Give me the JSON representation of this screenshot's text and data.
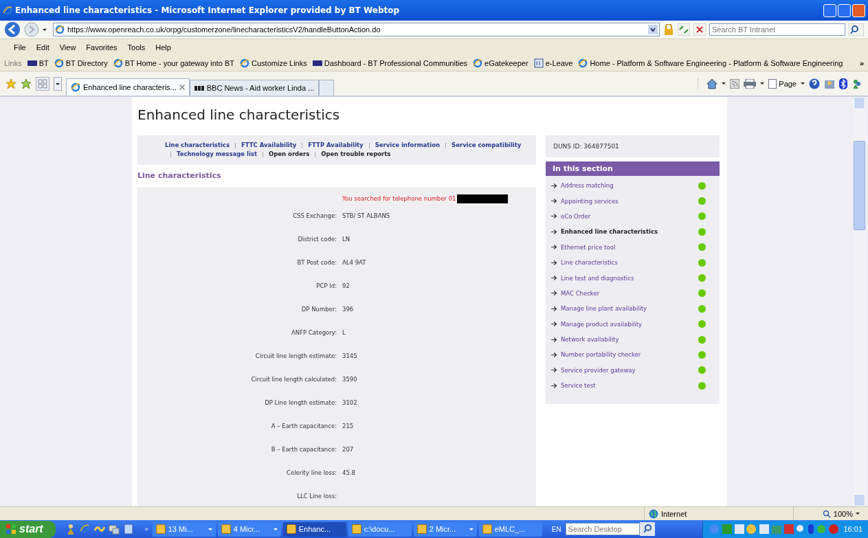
{
  "window": {
    "title": "Enhanced line characteristics - Microsoft Internet Explorer provided by BT Webtop"
  },
  "address_bar": {
    "url": "https://www.openreach.co.uk/orpg/customerzone/linecharacteristicsV2/handleButtonAction.do",
    "search_placeholder": "Search BT Intranet"
  },
  "menu": [
    "File",
    "Edit",
    "View",
    "Favorites",
    "Tools",
    "Help"
  ],
  "links_bar": {
    "label": "Links",
    "more": "»",
    "items": [
      {
        "label": "BT",
        "kind": "bt"
      },
      {
        "label": "BT Directory",
        "kind": "ie"
      },
      {
        "label": "BT Home - your gateway into BT",
        "kind": "ie"
      },
      {
        "label": "Customize Links",
        "kind": "ie"
      },
      {
        "label": "Dashboard - BT Professional Communities",
        "kind": "bt"
      },
      {
        "label": "eGatekeeper",
        "kind": "ie"
      },
      {
        "label": "e-Leave",
        "kind": "doc"
      },
      {
        "label": "Home - Platform & Software Engineering - Platform & Software Engineering",
        "kind": "ie"
      }
    ]
  },
  "tabs": [
    {
      "label": "Enhanced line characteris...",
      "selected": true,
      "kind": "ie"
    },
    {
      "label": "BBC News - Aid worker Linda ...",
      "selected": false,
      "kind": "bbc"
    }
  ],
  "command_bar": {
    "page": "Page"
  },
  "page": {
    "title": "Enhanced line characteristics",
    "nav": [
      {
        "label": "Line characteristics",
        "kind": "link"
      },
      {
        "label": "FTTC Availability",
        "kind": "link"
      },
      {
        "label": "FTTP Availability",
        "kind": "link"
      },
      {
        "label": "Service information",
        "kind": "link"
      },
      {
        "label": "Service compatibility",
        "kind": "link"
      },
      {
        "label": "Technology message list",
        "kind": "link"
      },
      {
        "label": "Open orders",
        "kind": "text"
      },
      {
        "label": "Open trouble reports",
        "kind": "text"
      }
    ],
    "section_heading": "Line characteristics",
    "search_notice": "You searched for telephone number 01",
    "fields": [
      {
        "label": "CSS Exchange:",
        "value": "STB/ ST ALBANS"
      },
      {
        "label": "District code:",
        "value": "LN"
      },
      {
        "label": "BT Post code:",
        "value": "AL4 9AT"
      },
      {
        "label": "PCP Id:",
        "value": "92"
      },
      {
        "label": "DP Number:",
        "value": "396"
      },
      {
        "label": "ANFP Category:",
        "value": "L"
      },
      {
        "label": "Circuit line length estimate:",
        "value": "3145"
      },
      {
        "label": "Circuit line length calculated:",
        "value": "3590"
      },
      {
        "label": "DP Line length estimate:",
        "value": "3102"
      },
      {
        "label": "A – Earth capacitance:",
        "value": "215"
      },
      {
        "label": "B – Earth capacitance:",
        "value": "207"
      },
      {
        "label": "Celerity line loss:",
        "value": "45.8"
      },
      {
        "label": "LLC Line loss:"
      }
    ],
    "sidebar": {
      "duns": "DUNS ID: 364877501",
      "heading": "In this section",
      "items": [
        {
          "label": "Address matching",
          "selected": false,
          "color": "#66cc00"
        },
        {
          "label": "Appointing services",
          "selected": false,
          "color": "#66cc00"
        },
        {
          "label": "eCo Order",
          "selected": false,
          "color": "#66cc00"
        },
        {
          "label": "Enhanced line characteristics",
          "selected": true,
          "color": "#66cc00"
        },
        {
          "label": "Ethernet price tool",
          "selected": false,
          "color": "#66cc00"
        },
        {
          "label": "Line characteristics",
          "selected": false,
          "color": "#66cc00"
        },
        {
          "label": "Line test and diagnostics",
          "selected": false,
          "color": "#66cc00"
        },
        {
          "label": "MAC Checker",
          "selected": false,
          "color": "#66cc00"
        },
        {
          "label": "Manage line plant availability",
          "selected": false,
          "color": "#66cc00"
        },
        {
          "label": "Manage product availability",
          "selected": false,
          "color": "#66cc00"
        },
        {
          "label": "Network availability",
          "selected": false,
          "color": "#66cc00"
        },
        {
          "label": "Number portability checker",
          "selected": false,
          "color": "#66cc00"
        },
        {
          "label": "Service provider gateway",
          "selected": false,
          "color": "#66cc00"
        },
        {
          "label": "Service test",
          "selected": false,
          "color": "#66cc00"
        }
      ]
    }
  },
  "status_bar": {
    "zone": "Internet",
    "zoom": "100%"
  },
  "taskbar": {
    "start": "start",
    "more": "»",
    "tasks": [
      {
        "label": "13 Mi...",
        "selected": false,
        "group": true
      },
      {
        "label": "4 Micr...",
        "selected": false,
        "group": true
      },
      {
        "label": "Enhanc...",
        "selected": true,
        "group": false
      },
      {
        "label": "c:\\docu...",
        "selected": false,
        "group": false
      },
      {
        "label": "2 Micr...",
        "selected": false,
        "group": true
      },
      {
        "label": "eMLC_...",
        "selected": false,
        "group": false
      }
    ],
    "language": "EN",
    "search_placeholder": "Search Desktop",
    "clock": "16:01"
  }
}
